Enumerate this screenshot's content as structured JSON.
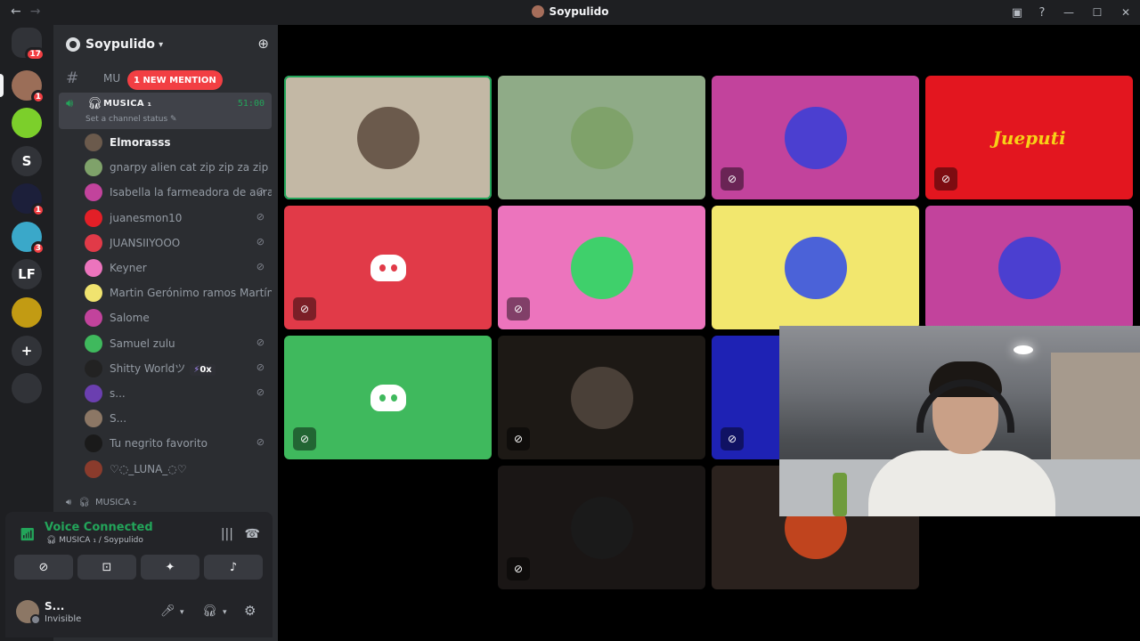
{
  "window": {
    "title": "Soypulido",
    "controls": [
      "inbox-icon",
      "help-icon",
      "minimize",
      "maximize",
      "close"
    ]
  },
  "servers": [
    {
      "label": "",
      "icon": "discord-home-icon",
      "badge": "17",
      "color": "#313338"
    },
    {
      "label": "",
      "icon": "server-avatar",
      "badge": "1",
      "color": "#9b6e58"
    },
    {
      "label": "",
      "icon": "server-avatar",
      "badge": "",
      "color": "#7ccf2b"
    },
    {
      "label": "S",
      "icon": "server-text",
      "badge": "",
      "color": "#313338"
    },
    {
      "label": "",
      "icon": "server-avatar",
      "badge": "1",
      "color": "#1c1f3a"
    },
    {
      "label": "",
      "icon": "server-avatar",
      "badge": "3",
      "color": "#3aa8c9"
    },
    {
      "label": "LF",
      "icon": "server-text",
      "badge": "",
      "color": "#313338"
    },
    {
      "label": "",
      "icon": "server-avatar",
      "badge": "",
      "color": "#c29b13"
    },
    {
      "label": "+",
      "icon": "add-server-icon",
      "badge": "",
      "color": "#313338"
    },
    {
      "label": "",
      "icon": "discover-icon",
      "badge": "",
      "color": "#313338"
    }
  ],
  "guild": {
    "name": "Soypulido"
  },
  "channels": {
    "text_partial": "MU",
    "new_mention": "1 NEW MENTION",
    "voice_active": {
      "name": "MUSICA ₁",
      "timer": "51:00",
      "status_placeholder": "Set a channel status"
    },
    "members": [
      {
        "name": "Elmorasss",
        "muted": false,
        "color": "#6b5a4c",
        "bright": true
      },
      {
        "name": "gnarpy alien cat zip zip za zip",
        "muted": false,
        "color": "#7fa26a",
        "bright": false
      },
      {
        "name": "Isabella la farmeadora de aura",
        "muted": true,
        "color": "#c2439c",
        "bright": false
      },
      {
        "name": "juanesmon10",
        "muted": true,
        "color": "#e31f27",
        "bright": false
      },
      {
        "name": "JUANSIIYOOO",
        "muted": true,
        "color": "#e13a48",
        "bright": false
      },
      {
        "name": "Keyner",
        "muted": true,
        "color": "#ec74bd",
        "bright": false
      },
      {
        "name": "Martin Gerónimo ramos Martínez",
        "muted": false,
        "color": "#f0e36f",
        "bright": false
      },
      {
        "name": "Salome",
        "muted": false,
        "color": "#c2439c",
        "bright": false
      },
      {
        "name": "Samuel zulu",
        "muted": true,
        "color": "#3fb95d",
        "bright": false
      },
      {
        "name": "Shitty Worldツ",
        "muted": true,
        "color": "#222",
        "bright": false,
        "boost": "0x"
      },
      {
        "name": "s...",
        "muted": true,
        "color": "#6b3fb0",
        "bright": false
      },
      {
        "name": "S...",
        "muted": false,
        "color": "#8c7765",
        "bright": false
      },
      {
        "name": "Tu negrito favorito",
        "muted": true,
        "color": "#1a1a1a",
        "bright": false
      },
      {
        "name": "♡◌_LUNA_◌♡",
        "muted": false,
        "color": "#8a3b2c",
        "bright": false
      }
    ],
    "voice_2": "MUSICA ₂"
  },
  "voice_panel": {
    "status": "Voice Connected",
    "sub": "MUSICA ₁ / Soypulido",
    "buttons": [
      "camera-off-icon",
      "share-screen-icon",
      "activities-icon",
      "soundboard-icon"
    ]
  },
  "user_panel": {
    "name": "S...",
    "status": "Invisible"
  },
  "tiles": [
    {
      "bg": "#c3b8a5",
      "type": "photo",
      "avatar": "#6b5a4c",
      "muted": false,
      "speaking": true
    },
    {
      "bg": "#8fab87",
      "type": "avatar",
      "avatar": "#7fa26a",
      "muted": false
    },
    {
      "bg": "#c2439c",
      "type": "avatar",
      "avatar": "#4b3fd0",
      "muted": true
    },
    {
      "bg": "#e3161f",
      "type": "brand",
      "text": "Jueputi",
      "muted": true
    },
    {
      "bg": "#e13a48",
      "type": "discord",
      "muted": true
    },
    {
      "bg": "#ec74bd",
      "type": "avatar",
      "avatar": "#3fd06b",
      "muted": true
    },
    {
      "bg": "#f2e76e",
      "type": "avatar",
      "avatar": "#4b62d8",
      "muted": false
    },
    {
      "bg": "#c2439c",
      "type": "avatar",
      "avatar": "#4b3fd0",
      "muted": false
    },
    {
      "bg": "#3fb95d",
      "type": "discord",
      "muted": true
    },
    {
      "bg": "#1d1915",
      "type": "avatar",
      "avatar": "#4a4038",
      "muted": true
    },
    {
      "bg": "#1e22b4",
      "type": "blank",
      "muted": true
    },
    {
      "bg": "#1a1615",
      "type": "avatar",
      "avatar": "#1a1a1a",
      "muted": true
    },
    {
      "bg": "#2b221e",
      "type": "avatar",
      "avatar": "#c0441e",
      "muted": false
    }
  ]
}
